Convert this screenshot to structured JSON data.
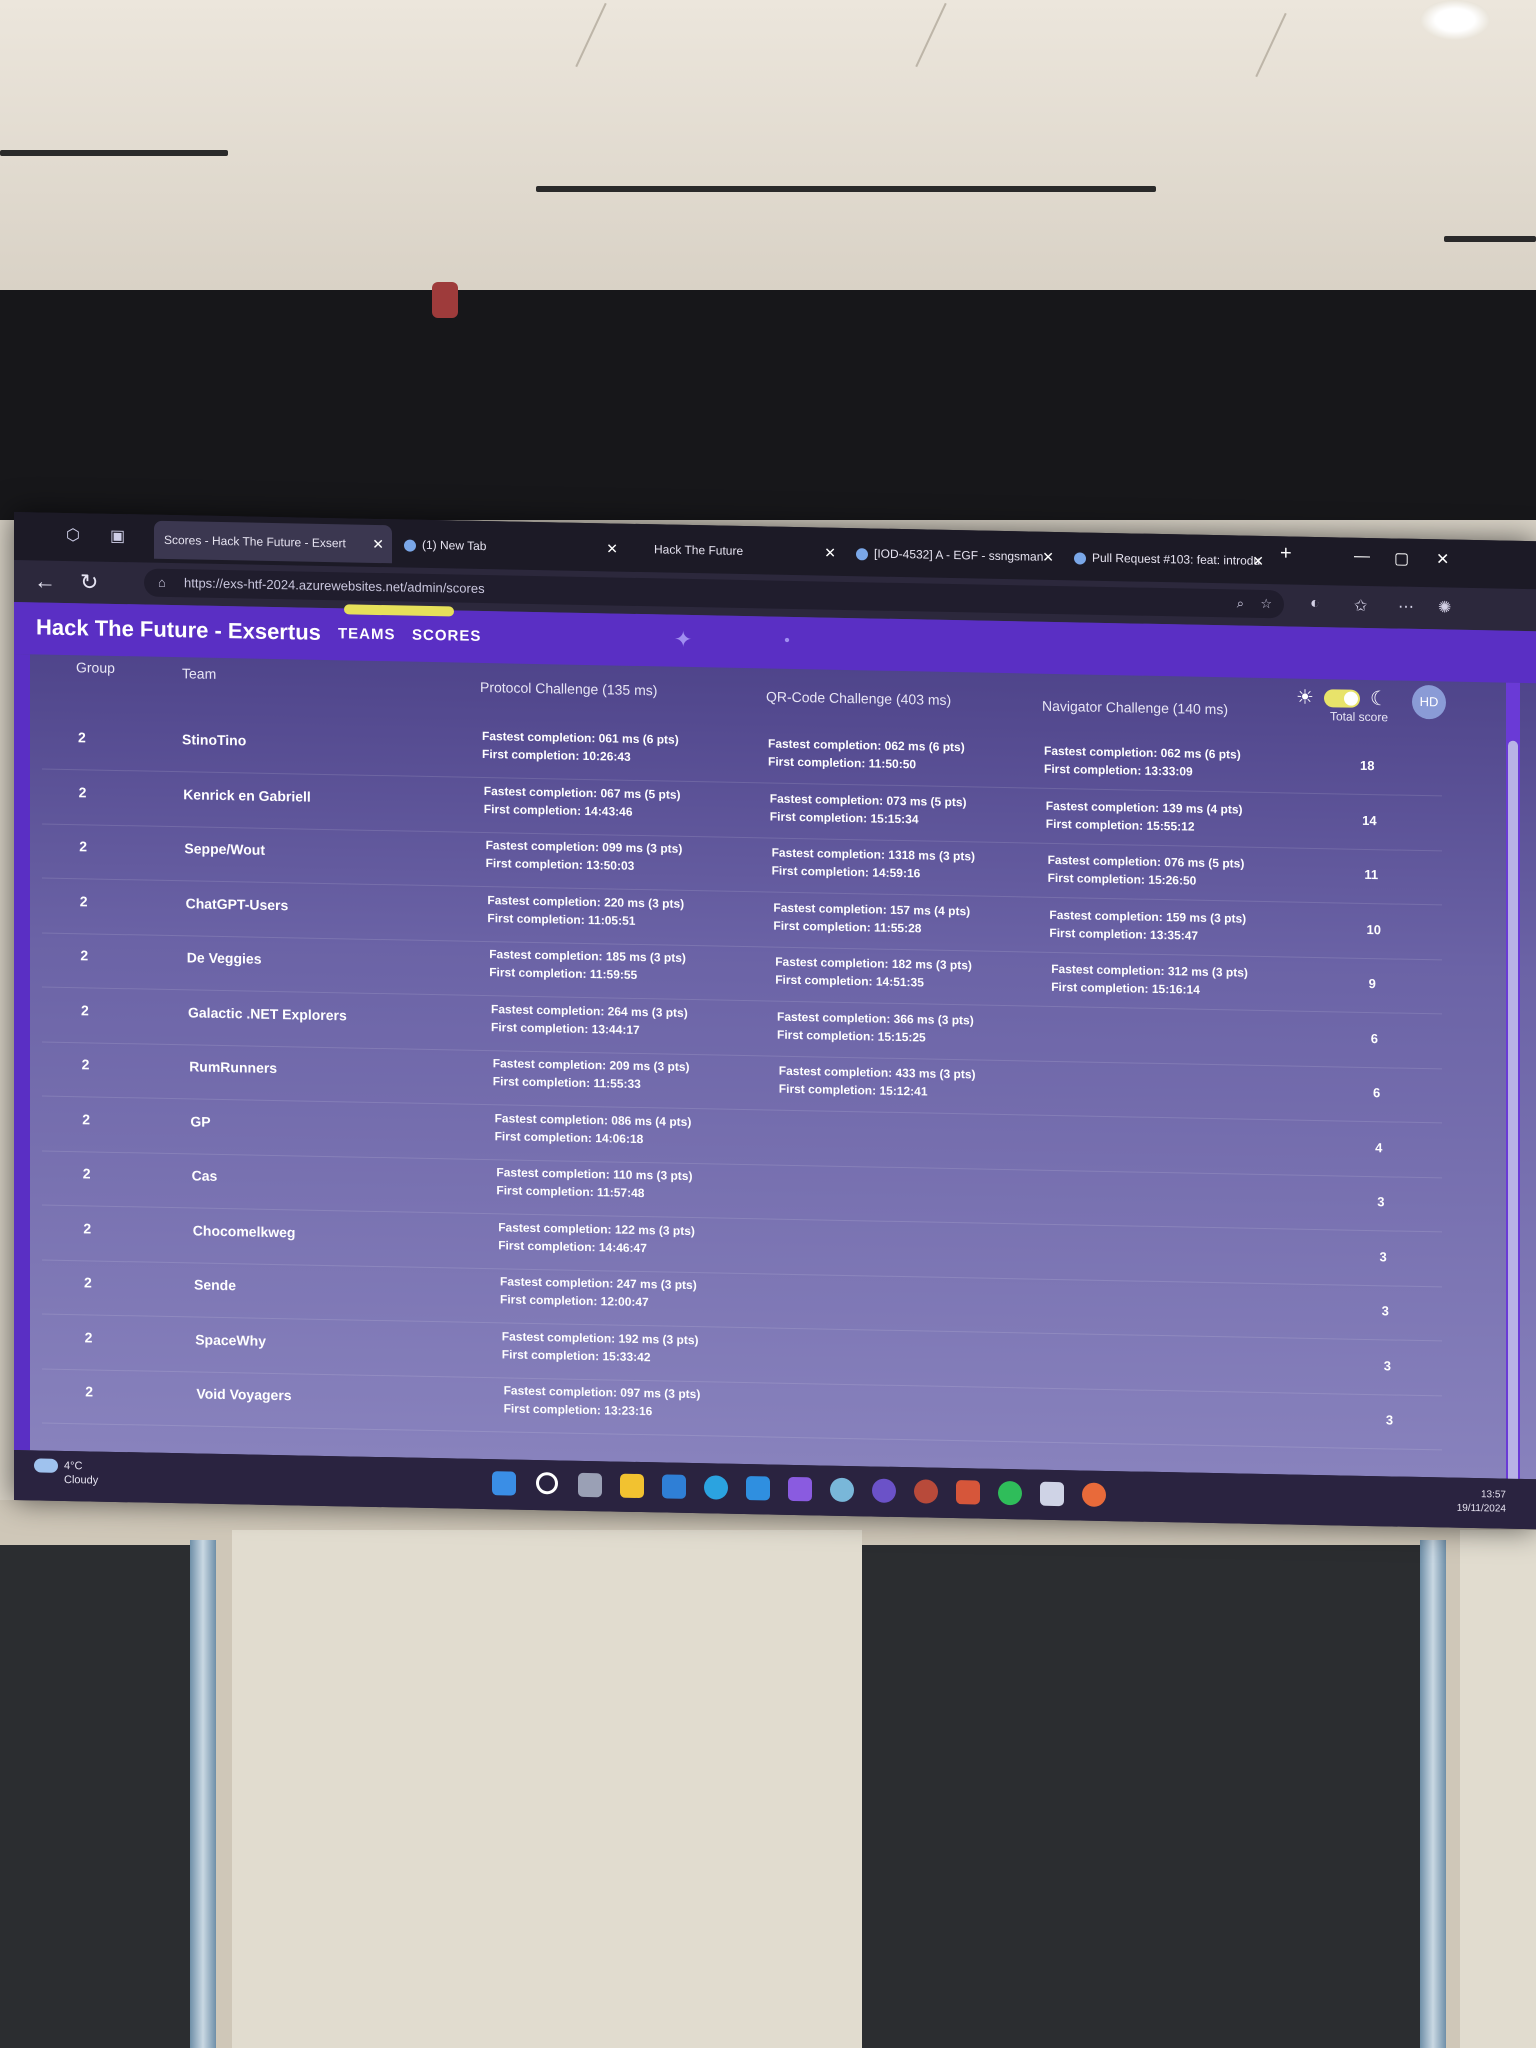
{
  "browser": {
    "tabs": [
      {
        "label": "Scores - Hack The Future - Exsert",
        "active": true
      },
      {
        "label": "(1) New Tab",
        "active": false
      },
      {
        "label": "Hack The Future",
        "active": false
      },
      {
        "label": "[IOD-4532] A - EGF - ssngsman",
        "active": false
      },
      {
        "label": "Pull Request #103: feat: introdu",
        "active": false
      }
    ],
    "new_tab": "+",
    "url": "https://exs-htf-2024.azurewebsites.net/admin/scores"
  },
  "app": {
    "title": "Hack The Future - Exsertus",
    "nav": [
      "TEAMS",
      "SCORES"
    ],
    "avatar": "HD"
  },
  "table": {
    "headers": {
      "group": "Group",
      "team": "Team",
      "c1": "Protocol Challenge (135 ms)",
      "c2": "QR-Code Challenge (403 ms)",
      "c3": "Navigator Challenge (140 ms)",
      "total": "Total score"
    },
    "rows": [
      {
        "group": "2",
        "team": "StinoTino",
        "c1f": "Fastest completion: 061 ms (6 pts)",
        "c1t": "First completion: 10:26:43",
        "c2f": "Fastest completion: 062 ms (6 pts)",
        "c2t": "First completion: 11:50:50",
        "c3f": "Fastest completion: 062 ms (6 pts)",
        "c3t": "First completion: 13:33:09",
        "total": "18"
      },
      {
        "group": "2",
        "team": "Kenrick en Gabriell",
        "c1f": "Fastest completion: 067 ms (5 pts)",
        "c1t": "First completion: 14:43:46",
        "c2f": "Fastest completion: 073 ms (5 pts)",
        "c2t": "First completion: 15:15:34",
        "c3f": "Fastest completion: 139 ms (4 pts)",
        "c3t": "First completion: 15:55:12",
        "total": "14"
      },
      {
        "group": "2",
        "team": "Seppe/Wout",
        "c1f": "Fastest completion: 099 ms (3 pts)",
        "c1t": "First completion: 13:50:03",
        "c2f": "Fastest completion: 1318 ms (3 pts)",
        "c2t": "First completion: 14:59:16",
        "c3f": "Fastest completion: 076 ms (5 pts)",
        "c3t": "First completion: 15:26:50",
        "total": "11"
      },
      {
        "group": "2",
        "team": "ChatGPT-Users",
        "c1f": "Fastest completion: 220 ms (3 pts)",
        "c1t": "First completion: 11:05:51",
        "c2f": "Fastest completion: 157 ms (4 pts)",
        "c2t": "First completion: 11:55:28",
        "c3f": "Fastest completion: 159 ms (3 pts)",
        "c3t": "First completion: 13:35:47",
        "total": "10"
      },
      {
        "group": "2",
        "team": "De Veggies",
        "c1f": "Fastest completion: 185 ms (3 pts)",
        "c1t": "First completion: 11:59:55",
        "c2f": "Fastest completion: 182 ms (3 pts)",
        "c2t": "First completion: 14:51:35",
        "c3f": "Fastest completion: 312 ms (3 pts)",
        "c3t": "First completion: 15:16:14",
        "total": "9"
      },
      {
        "group": "2",
        "team": "Galactic .NET Explorers",
        "c1f": "Fastest completion: 264 ms (3 pts)",
        "c1t": "First completion: 13:44:17",
        "c2f": "Fastest completion: 366 ms (3 pts)",
        "c2t": "First completion: 15:15:25",
        "c3f": "",
        "c3t": "",
        "total": "6"
      },
      {
        "group": "2",
        "team": "RumRunners",
        "c1f": "Fastest completion: 209 ms (3 pts)",
        "c1t": "First completion: 11:55:33",
        "c2f": "Fastest completion: 433 ms (3 pts)",
        "c2t": "First completion: 15:12:41",
        "c3f": "",
        "c3t": "",
        "total": "6"
      },
      {
        "group": "2",
        "team": "GP",
        "c1f": "Fastest completion: 086 ms (4 pts)",
        "c1t": "First completion: 14:06:18",
        "c2f": "",
        "c2t": "",
        "c3f": "",
        "c3t": "",
        "total": "4"
      },
      {
        "group": "2",
        "team": "Cas",
        "c1f": "Fastest completion: 110 ms (3 pts)",
        "c1t": "First completion: 11:57:48",
        "c2f": "",
        "c2t": "",
        "c3f": "",
        "c3t": "",
        "total": "3"
      },
      {
        "group": "2",
        "team": "Chocomelkweg",
        "c1f": "Fastest completion: 122 ms (3 pts)",
        "c1t": "First completion: 14:46:47",
        "c2f": "",
        "c2t": "",
        "c3f": "",
        "c3t": "",
        "total": "3"
      },
      {
        "group": "2",
        "team": "Sende",
        "c1f": "Fastest completion: 247 ms (3 pts)",
        "c1t": "First completion: 12:00:47",
        "c2f": "",
        "c2t": "",
        "c3f": "",
        "c3t": "",
        "total": "3"
      },
      {
        "group": "2",
        "team": "SpaceWhy",
        "c1f": "Fastest completion: 192 ms (3 pts)",
        "c1t": "First completion: 15:33:42",
        "c2f": "",
        "c2t": "",
        "c3f": "",
        "c3t": "",
        "total": "3"
      },
      {
        "group": "2",
        "team": "Void Voyagers",
        "c1f": "Fastest completion: 097 ms (3 pts)",
        "c1t": "First completion: 13:23:16",
        "c2f": "",
        "c2t": "",
        "c3f": "",
        "c3t": "",
        "total": "3"
      }
    ]
  },
  "taskbar": {
    "temp": "4°C",
    "weather": "Cloudy",
    "time": "13:57",
    "date": "19/11/2024"
  }
}
